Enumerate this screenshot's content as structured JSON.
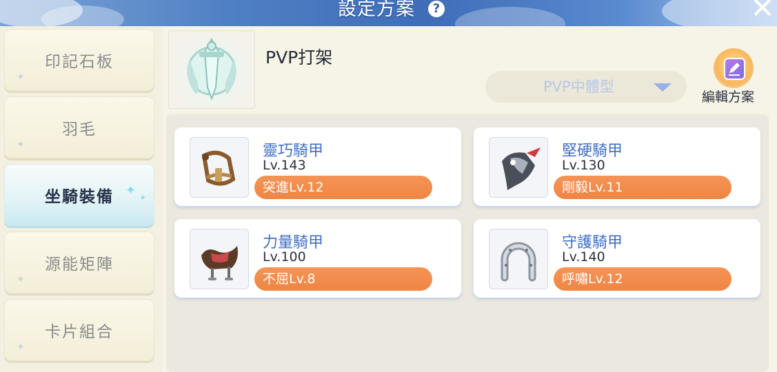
{
  "header": {
    "title": "設定方案",
    "help_glyph": "?",
    "close_glyph": "✕",
    "icons": [
      "help-icon",
      "close-icon"
    ]
  },
  "sidebar": {
    "items": [
      {
        "label": "印記石板",
        "active": false
      },
      {
        "label": "羽毛",
        "active": false
      },
      {
        "label": "坐騎裝備",
        "active": true
      },
      {
        "label": "源能矩陣",
        "active": false
      },
      {
        "label": "卡片組合",
        "active": false
      }
    ]
  },
  "plan": {
    "name": "PVP打架",
    "dropdown_value": "PVP中體型",
    "edit_label": "編輯方案"
  },
  "equipment": [
    {
      "name": "靈巧騎甲",
      "level": "Lv.143",
      "skill": "突進Lv.12",
      "icon": "bridle-icon"
    },
    {
      "name": "堅硬騎甲",
      "level": "Lv.130",
      "skill": "剛毅Lv.11",
      "icon": "horse-armor-icon"
    },
    {
      "name": "力量騎甲",
      "level": "Lv.100",
      "skill": "不屈Lv.8",
      "icon": "saddle-icon"
    },
    {
      "name": "守護騎甲",
      "level": "Lv.140",
      "skill": "呼嘯Lv.12",
      "icon": "horseshoe-icon"
    }
  ],
  "colors": {
    "header_blue": "#4f7fc4",
    "accent_orange": "#ef8545",
    "item_name_blue": "#3f6fc7",
    "active_tab_cyan": "#c9e8f1"
  }
}
